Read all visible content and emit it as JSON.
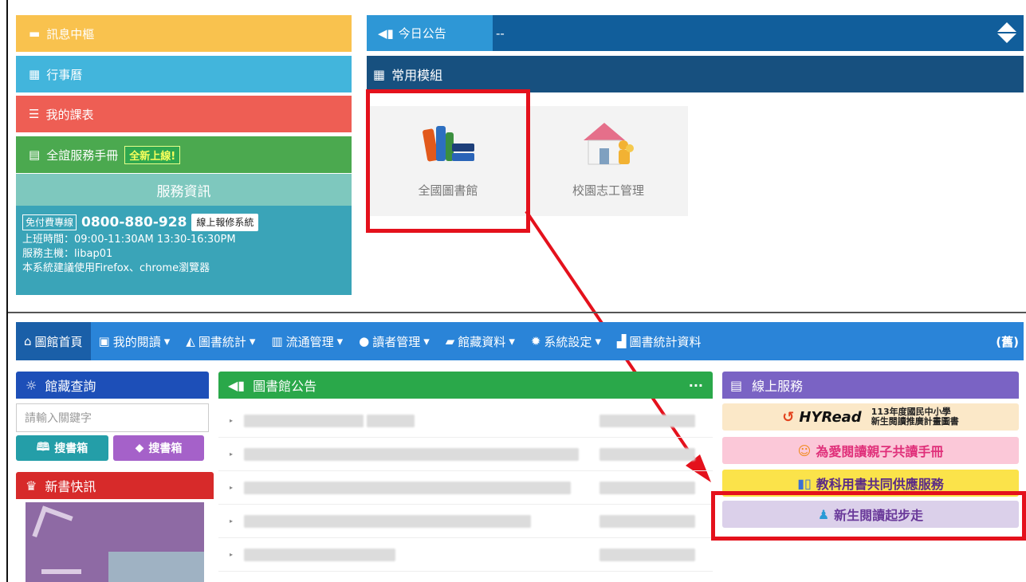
{
  "left_menu": {
    "messages": "訊息中樞",
    "calendar": "行事曆",
    "schedule": "我的課表",
    "manual": "全誼服務手冊",
    "manual_badge": "全新上線!",
    "colors": [
      "#f9c24e",
      "#42b5dc",
      "#ee5e54",
      "#4ba94f"
    ]
  },
  "service_info": {
    "title": "服務資訊",
    "hotline_tag": "免付費專線",
    "phone": "0800-880-928",
    "repair_button": "線上報修系統",
    "hours": "上班時間：09:00-11:30AM 13:30-16:30PM",
    "host": "服務主機：libap01",
    "browser_note": "本系統建議使用Firefox、chrome瀏覽器"
  },
  "announcement_bar": {
    "label": "今日公告",
    "text": "--"
  },
  "modules": {
    "title": "常用模組",
    "items": [
      {
        "label": "全國圖書館",
        "icon": "books-icon"
      },
      {
        "label": "校園志工管理",
        "icon": "house-people-icon"
      }
    ]
  },
  "navbar": {
    "items": [
      {
        "label": "圖館首頁",
        "icon": "home-icon",
        "dropdown": false
      },
      {
        "label": "我的閱讀",
        "icon": "user-card-icon",
        "dropdown": true
      },
      {
        "label": "圖書統計",
        "icon": "area-chart-icon",
        "dropdown": true
      },
      {
        "label": "流通管理",
        "icon": "barcode-icon",
        "dropdown": true
      },
      {
        "label": "讀者管理",
        "icon": "user-icon",
        "dropdown": true
      },
      {
        "label": "館藏資料",
        "icon": "book-icon",
        "dropdown": true
      },
      {
        "label": "系統設定",
        "icon": "gear-icon",
        "dropdown": true
      },
      {
        "label": "圖書統計資料",
        "icon": "bar-chart-icon",
        "dropdown": false
      }
    ],
    "right_text": "(舊)"
  },
  "collection_search": {
    "title": "館藏查詢",
    "placeholder": "請輸入關鍵字",
    "btn1": "搜書箱",
    "btn2": "搜書箱"
  },
  "new_books": {
    "title": "新書快訊"
  },
  "library_announcements": {
    "title": "圖書館公告",
    "more": "···"
  },
  "online_services": {
    "title": "線上服務",
    "hyread_logo": "HYRead",
    "hyread_line1": "113年度國民中小學",
    "hyread_line2": "新生閱讀推廣計畫圖書",
    "banner2": "為愛閱讀親子共讀手冊",
    "banner3": "教科用書共同供應服務",
    "banner4": "新生閱讀起步走"
  }
}
